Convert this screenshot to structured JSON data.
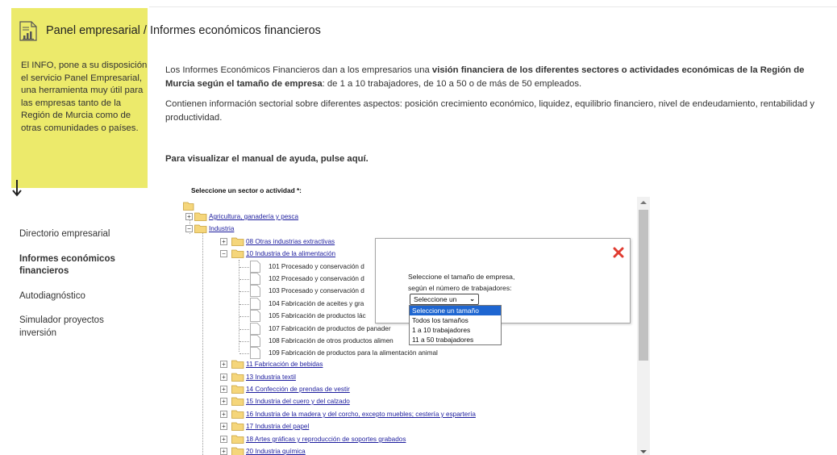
{
  "header": {
    "title": "Panel empresarial / Informes económicos financieros"
  },
  "info_panel": {
    "text": "El INFO, pone a su disposición el servicio Panel Empresarial, una herramienta muy útil para las empresas tanto de la Región de Murcia como de otras comunidades o países."
  },
  "nav": {
    "items": [
      {
        "label": "Directorio empresarial"
      },
      {
        "label": "Informes económicos financieros"
      },
      {
        "label": "Autodiagnóstico"
      },
      {
        "label": "Simulador proyectos inversión"
      }
    ]
  },
  "intro": {
    "p1_a": "Los Informes Económicos Financieros dan a los empresarios una ",
    "p1_b": "visión financiera de los diferentes sectores o actividades económicas de la Región de Murcia según el tamaño de empresa",
    "p1_c": ": de 1 a 10 trabajadores, de 10 a 50 o de más de 50 empleados.",
    "p2": "Contienen información sectorial sobre diferentes aspectos: posición crecimiento económico, liquidez, equilibrio financiero, nivel de endeudamiento, rentabilidad y productividad.",
    "help": "Para visualizar el manual de ayuda, pulse aquí."
  },
  "tree": {
    "label": "Seleccione un sector o actividad *:",
    "top_items": [
      {
        "label": "Agricultura, ganadería y pesca"
      },
      {
        "label": "Industria"
      }
    ],
    "industria_children_before": [
      {
        "label": "08 Otras industrias extractivas"
      },
      {
        "label": "10 Industria de la alimentación"
      }
    ],
    "alimentacion_children": [
      {
        "label": "101 Procesado y conservación d"
      },
      {
        "label": "102 Procesado y conservación d"
      },
      {
        "label": "103 Procesado y conservación d"
      },
      {
        "label": "104 Fabricación de aceites y gra"
      },
      {
        "label": "105 Fabricación de productos lác"
      },
      {
        "label": "107 Fabricación de productos de panader"
      },
      {
        "label": "108 Fabricación de otros productos alimen"
      },
      {
        "label": "109 Fabricación de productos para la alimentación animal"
      }
    ],
    "industria_children_after": [
      {
        "label": "11 Fabricación de bebidas"
      },
      {
        "label": "13 Industria textil"
      },
      {
        "label": "14 Confección de prendas de vestir"
      },
      {
        "label": "15 Industria del cuero y del calzado"
      },
      {
        "label": "16 Industria de la madera y del corcho, excepto muebles; cestería y espartería"
      },
      {
        "label": "17 Industria del papel"
      },
      {
        "label": "18 Artes gráficas y reproducción de soportes grabados"
      },
      {
        "label": "20 Industria química"
      }
    ]
  },
  "popup": {
    "line1": "Seleccione el tamaño de empresa,",
    "line2": "según el número de trabajadores:",
    "select_value": "Seleccione un tamaño",
    "options": [
      "Seleccione un tamaño",
      "Todos los tamaños",
      "1 a 10 trabajadores",
      "11 a 50 trabajadores"
    ]
  },
  "colors": {
    "panel_yellow": "#ecea6b",
    "link_blue": "#1d1d9e",
    "close_red": "#e03c31",
    "option_highlight": "#1e66d1"
  }
}
